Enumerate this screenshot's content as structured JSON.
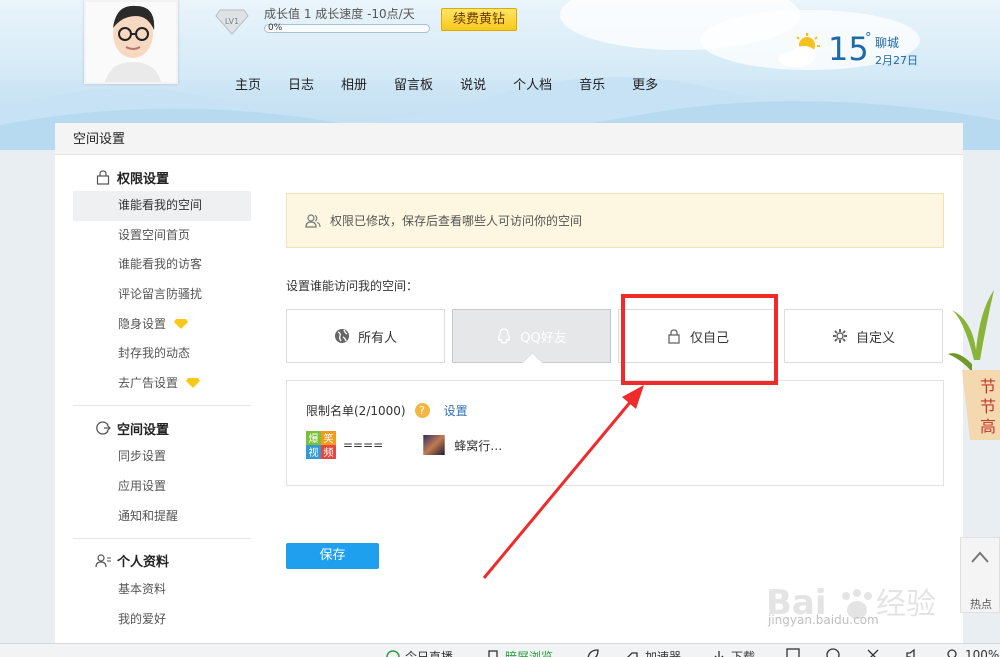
{
  "profile": {
    "level_badge": "LV1",
    "growth_text": "成长值 1   成长速度 -10点/天",
    "growth_progress": "0%",
    "renew_button": "续费黄钻"
  },
  "nav": [
    "主页",
    "日志",
    "相册",
    "留言板",
    "说说",
    "个人档",
    "音乐",
    "更多"
  ],
  "weather": {
    "temp": "15",
    "deg": "°",
    "city": "聊城",
    "date": "2月27日"
  },
  "panel_title": "空间设置",
  "sidebar": {
    "groups": [
      {
        "title": "权限设置",
        "icon": "lock-icon",
        "items": [
          {
            "label": "谁能看我的空间",
            "active": true
          },
          {
            "label": "设置空间首页"
          },
          {
            "label": "谁能看我的访客"
          },
          {
            "label": "评论留言防骚扰"
          },
          {
            "label": "隐身设置",
            "gem": true
          },
          {
            "label": "封存我的动态"
          },
          {
            "label": "去广告设置",
            "gem": true
          }
        ]
      },
      {
        "title": "空间设置",
        "icon": "space-settings-icon",
        "items": [
          {
            "label": "同步设置"
          },
          {
            "label": "应用设置"
          },
          {
            "label": "通知和提醒"
          }
        ]
      },
      {
        "title": "个人资料",
        "icon": "profile-icon",
        "items": [
          {
            "label": "基本资料"
          },
          {
            "label": "我的爱好"
          }
        ]
      }
    ]
  },
  "notice": "权限已修改，保存后查看哪些人可访问你的空间",
  "question": "设置谁能访问我的空间：",
  "options": [
    {
      "label": "所有人",
      "icon": "globe-icon"
    },
    {
      "label": "QQ好友",
      "icon": "qq-penguin-icon",
      "selected": true
    },
    {
      "label": "仅自己",
      "icon": "lock-icon"
    },
    {
      "label": "自定义",
      "icon": "gear-icon"
    }
  ],
  "restrict": {
    "title": "限制名单(2/1000)",
    "help": "?",
    "set_link": "设置",
    "members": [
      {
        "name": "====",
        "thumb_text": "爆笑视频"
      },
      {
        "name": "蜂窝行…"
      }
    ]
  },
  "save_button": "保存",
  "hot": {
    "label": "热点"
  },
  "watermark": {
    "brand": "Bai 经验",
    "url": "jingyan.baidu.com"
  },
  "status_bar": [
    "今日直播",
    "暗屏浏览",
    "加速器",
    "下载",
    "100%"
  ],
  "colors": {
    "accent": "#1fa0ef",
    "annotation": "#ef2b2b",
    "vip_gold": "#f8c91b",
    "link": "#2e6fb8"
  }
}
